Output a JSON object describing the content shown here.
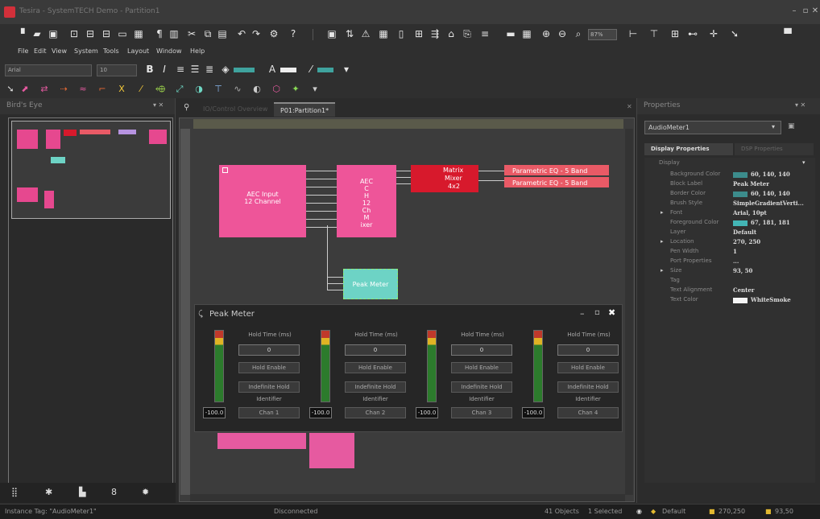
{
  "window": {
    "title": "Tesira - SystemTECH Demo - Partition1",
    "controls": [
      "–",
      "▫",
      "✕"
    ]
  },
  "toolbar1": {
    "zoom": "87%"
  },
  "menu": [
    "File",
    "Edit",
    "View",
    "System",
    "Tools",
    "Layout",
    "Window",
    "Help"
  ],
  "toolbar2": {
    "font": "Arial",
    "size": "10"
  },
  "birdseye": {
    "title": "Bird's Eye"
  },
  "tabs": [
    "IO/Control Overview",
    "P01:Partition1*"
  ],
  "canvas": {
    "aec_label": "AEC Input\n12 Channel",
    "mixer_label": "AEC\nC\nH\n12\nCh\nM\nixer",
    "matrix": {
      "title": "Matrix",
      "line2": "Mixer",
      "line3": "4x2"
    },
    "peq1": "Parametric EQ - 5 Band",
    "peq2": "Parametric EQ - 5 Band",
    "peak_label": "Peak Meter"
  },
  "peak_meter": {
    "title": "Peak Meter",
    "channels": [
      {
        "hold_time_label": "Hold Time (ms)",
        "hold_time": "0",
        "hold_enable": "Hold Enable",
        "indefinite": "Indefinite Hold",
        "identifier_label": "Identifier",
        "identifier": "Chan 1",
        "level": "-100.0"
      },
      {
        "hold_time_label": "Hold Time (ms)",
        "hold_time": "0",
        "hold_enable": "Hold Enable",
        "indefinite": "Indefinite Hold",
        "identifier_label": "Identifier",
        "identifier": "Chan 2",
        "level": "-100.0"
      },
      {
        "hold_time_label": "Hold Time (ms)",
        "hold_time": "0",
        "hold_enable": "Hold Enable",
        "indefinite": "Indefinite Hold",
        "identifier_label": "Identifier",
        "identifier": "Chan 3",
        "level": "-100.0"
      },
      {
        "hold_time_label": "Hold Time (ms)",
        "hold_time": "0",
        "hold_enable": "Hold Enable",
        "indefinite": "Indefinite Hold",
        "identifier_label": "Identifier",
        "identifier": "Chan 4",
        "level": "-100.0"
      }
    ]
  },
  "properties": {
    "title": "Properties",
    "selected": "AudioMeter1",
    "tab1": "Display Properties",
    "tab2": "DSP Properties",
    "section": "Display",
    "rows": [
      {
        "key": "Background Color",
        "value": "60, 140, 140",
        "swatch": "#3c8c8c"
      },
      {
        "key": "Block Label",
        "value": "Peak Meter"
      },
      {
        "key": "Border Color",
        "value": "60, 140, 140",
        "swatch": "#3c8c8c"
      },
      {
        "key": "Brush Style",
        "value": "SimpleGradientVerti..."
      },
      {
        "key": "Font",
        "value": "Arial, 10pt"
      },
      {
        "key": "Foreground Color",
        "value": "67, 181, 181",
        "swatch": "#43b5b5"
      },
      {
        "key": "Layer",
        "value": "Default"
      },
      {
        "key": "Location",
        "value": "270, 250"
      },
      {
        "key": "Pen Width",
        "value": "1"
      },
      {
        "key": "Port Properties",
        "value": "..."
      },
      {
        "key": "Size",
        "value": "93, 50"
      },
      {
        "key": "Tag",
        "value": ""
      },
      {
        "key": "Text Alignment",
        "value": "Center"
      },
      {
        "key": "Text Color",
        "value": "WhiteSmoke",
        "swatch": "#f5f5f5"
      }
    ]
  },
  "status": {
    "instance": "Instance Tag: \"AudioMeter1\"",
    "connection": "Disconnected",
    "objects": "41 Objects",
    "selected": "1 Selected",
    "layer": "Default",
    "coords": "270,250",
    "size": "93,50"
  }
}
